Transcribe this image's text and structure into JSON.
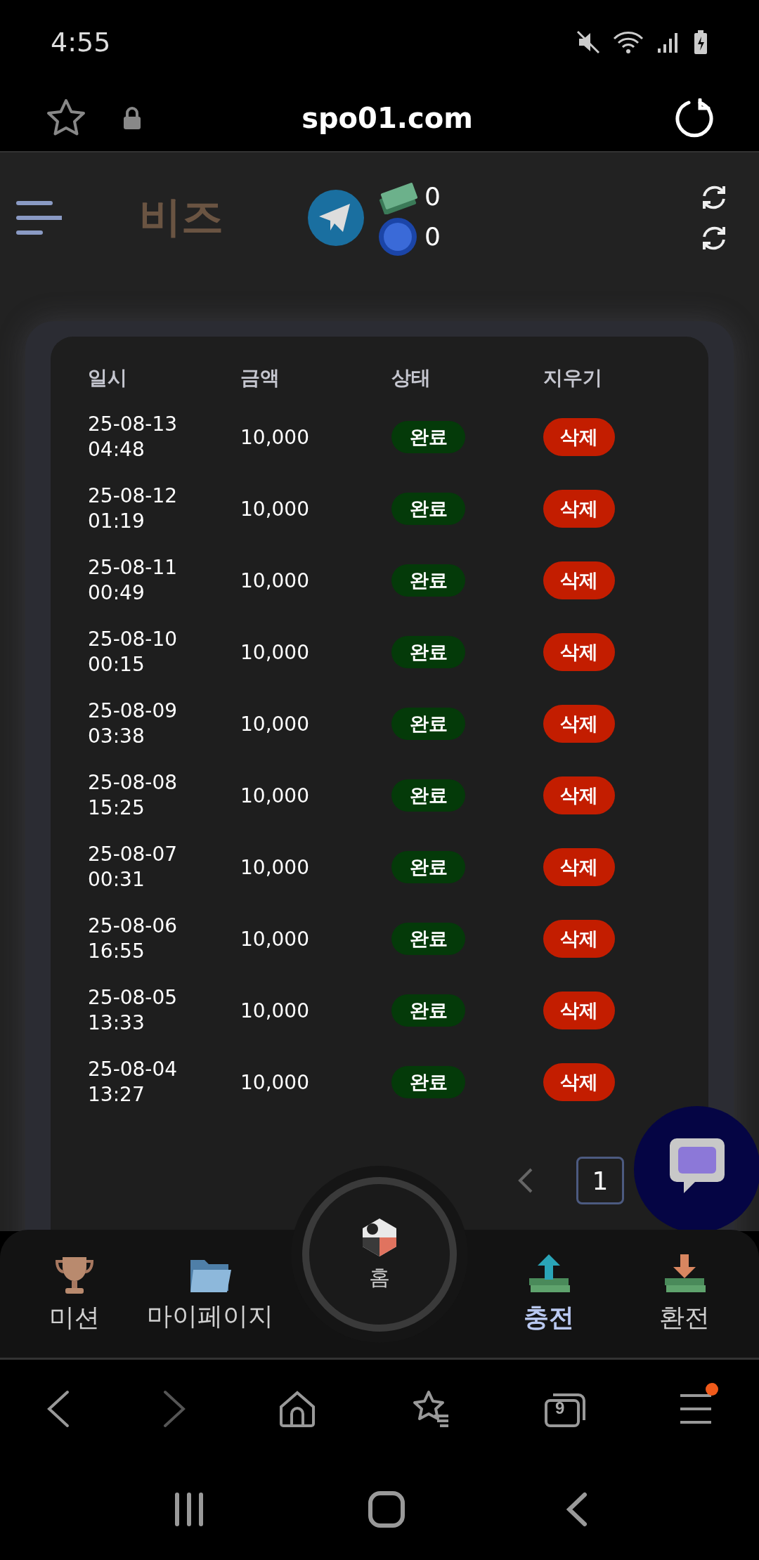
{
  "status_bar": {
    "time": "4:55"
  },
  "browser": {
    "url": "spo01.com",
    "tab_count": "9",
    "menu_badge": true
  },
  "header": {
    "logo_text": "비즈",
    "balances": [
      {
        "kind": "cash",
        "value": "0"
      },
      {
        "kind": "points",
        "value": "0"
      }
    ]
  },
  "table": {
    "columns": [
      "일시",
      "금액",
      "상태",
      "지우기"
    ],
    "rows": [
      {
        "date": "25-08-13",
        "time": "04:48",
        "amount": "10,000",
        "status": "완료",
        "action": "삭제"
      },
      {
        "date": "25-08-12",
        "time": "01:19",
        "amount": "10,000",
        "status": "완료",
        "action": "삭제"
      },
      {
        "date": "25-08-11",
        "time": "00:49",
        "amount": "10,000",
        "status": "완료",
        "action": "삭제"
      },
      {
        "date": "25-08-10",
        "time": "00:15",
        "amount": "10,000",
        "status": "완료",
        "action": "삭제"
      },
      {
        "date": "25-08-09",
        "time": "03:38",
        "amount": "10,000",
        "status": "완료",
        "action": "삭제"
      },
      {
        "date": "25-08-08",
        "time": "15:25",
        "amount": "10,000",
        "status": "완료",
        "action": "삭제"
      },
      {
        "date": "25-08-07",
        "time": "00:31",
        "amount": "10,000",
        "status": "완료",
        "action": "삭제"
      },
      {
        "date": "25-08-06",
        "time": "16:55",
        "amount": "10,000",
        "status": "완료",
        "action": "삭제"
      },
      {
        "date": "25-08-05",
        "time": "13:33",
        "amount": "10,000",
        "status": "완료",
        "action": "삭제"
      },
      {
        "date": "25-08-04",
        "time": "13:27",
        "amount": "10,000",
        "status": "완료",
        "action": "삭제"
      }
    ]
  },
  "pagination": {
    "pages": [
      {
        "label": "1",
        "selected": true
      }
    ]
  },
  "bottom_nav": [
    {
      "kind": "trophy",
      "label": "미션",
      "selected": false
    },
    {
      "kind": "folder",
      "label": "마이페이지",
      "selected": false
    },
    {
      "kind": "home",
      "label": "홈",
      "selected": false
    },
    {
      "kind": "deposit",
      "label": "충전",
      "selected": true
    },
    {
      "kind": "withdraw",
      "label": "환전",
      "selected": false
    }
  ]
}
